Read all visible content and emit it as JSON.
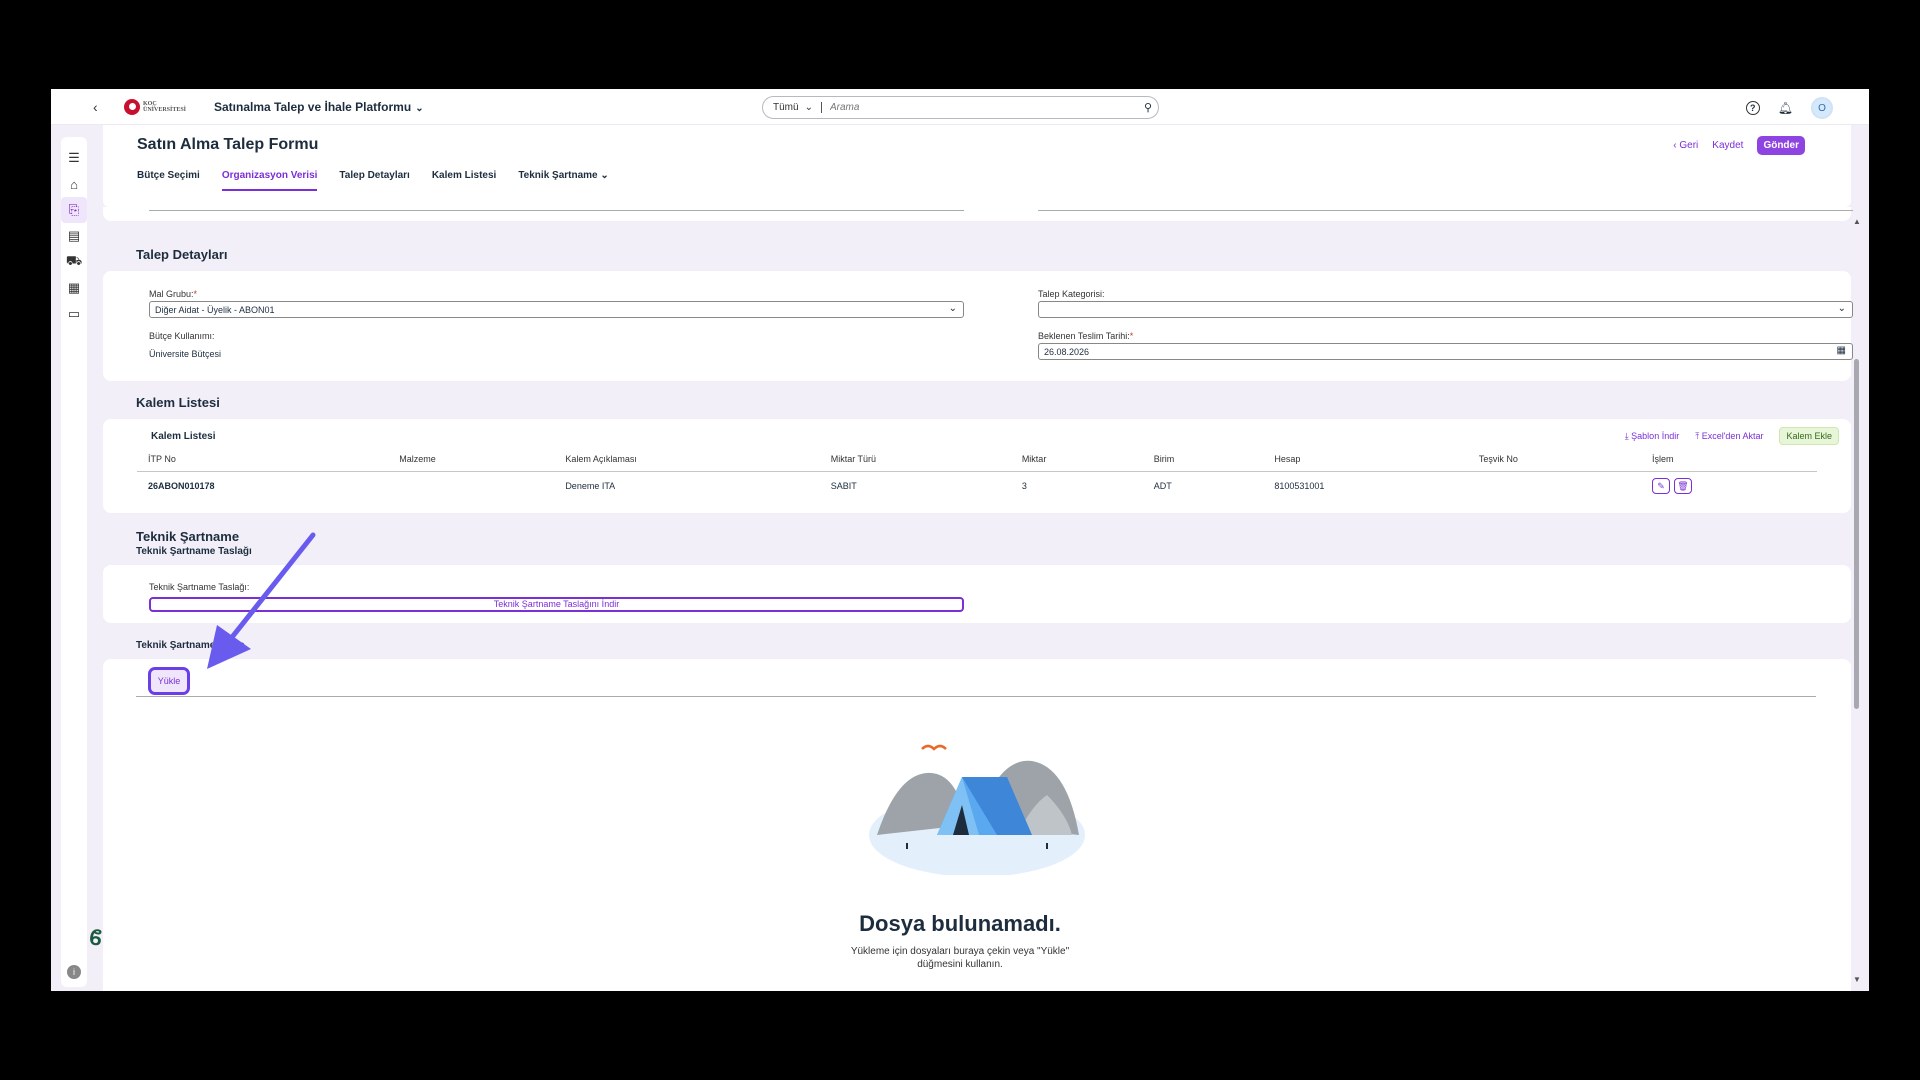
{
  "shell": {
    "back": "‹",
    "logo_text": "KOÇ ÜNİVERSİTESİ",
    "app_title": "Satınalma Talep ve İhale Platformu",
    "search_scope": "Tümü",
    "search_placeholder": "Arama",
    "avatar": "O"
  },
  "page": {
    "title": "Satın Alma Talep Formu",
    "actions": {
      "back": "Geri",
      "save": "Kaydet",
      "send": "Gönder"
    },
    "tabs": [
      {
        "label": "Bütçe Seçimi"
      },
      {
        "label": "Organizasyon Verisi",
        "active": true
      },
      {
        "label": "Talep Detayları"
      },
      {
        "label": "Kalem Listesi"
      },
      {
        "label": "Teknik Şartname"
      }
    ]
  },
  "talep": {
    "title": "Talep Detayları",
    "mal_grubu_label": "Mal Grubu:",
    "mal_grubu_value": "Diğer Aidat - Üyelik - ABON01",
    "talep_kategorisi_label": "Talep Kategorisi:",
    "talep_kategorisi_value": "",
    "butce_label": "Bütçe Kullanımı:",
    "butce_value": "Üniversite Bütçesi",
    "teslim_label": "Beklenen Teslim Tarihi:",
    "teslim_value": "26.08.2026"
  },
  "kalem": {
    "section_title": "Kalem Listesi",
    "table_title": "Kalem Listesi",
    "tools": {
      "template": "Şablon İndir",
      "excel": "Excel'den Aktar",
      "add": "Kalem Ekle"
    },
    "columns": [
      "İTP No",
      "Malzeme",
      "Kalem Açıklaması",
      "Miktar Türü",
      "Miktar",
      "Birim",
      "Hesap",
      "Teşvik No",
      "İşlem"
    ],
    "rows": [
      {
        "itp": "26ABON010178",
        "malzeme": "",
        "aciklama": "Deneme ITA",
        "miktar_turu": "SABIT",
        "miktar": "3",
        "birim": "ADT",
        "hesap": "8100531001",
        "tesvik": ""
      }
    ]
  },
  "teknik": {
    "title": "Teknik Şartname",
    "taslak_title": "Teknik Şartname Taslağı",
    "taslak_label": "Teknik Şartname Taslağı:",
    "download_label": "Teknik Şartname Taslağını İndir",
    "upload_title": "Teknik Şartname Yükle",
    "upload_button": "Yükle",
    "empty_title": "Dosya bulunamadı.",
    "empty_line1": "Yükleme için dosyaları buraya çekin veya \"Yükle\"",
    "empty_line2": "düğmesini kullanın."
  },
  "colors": {
    "accent": "#7b2fd6",
    "primary_button": "#8e44e0",
    "background": "#f2eff8"
  }
}
